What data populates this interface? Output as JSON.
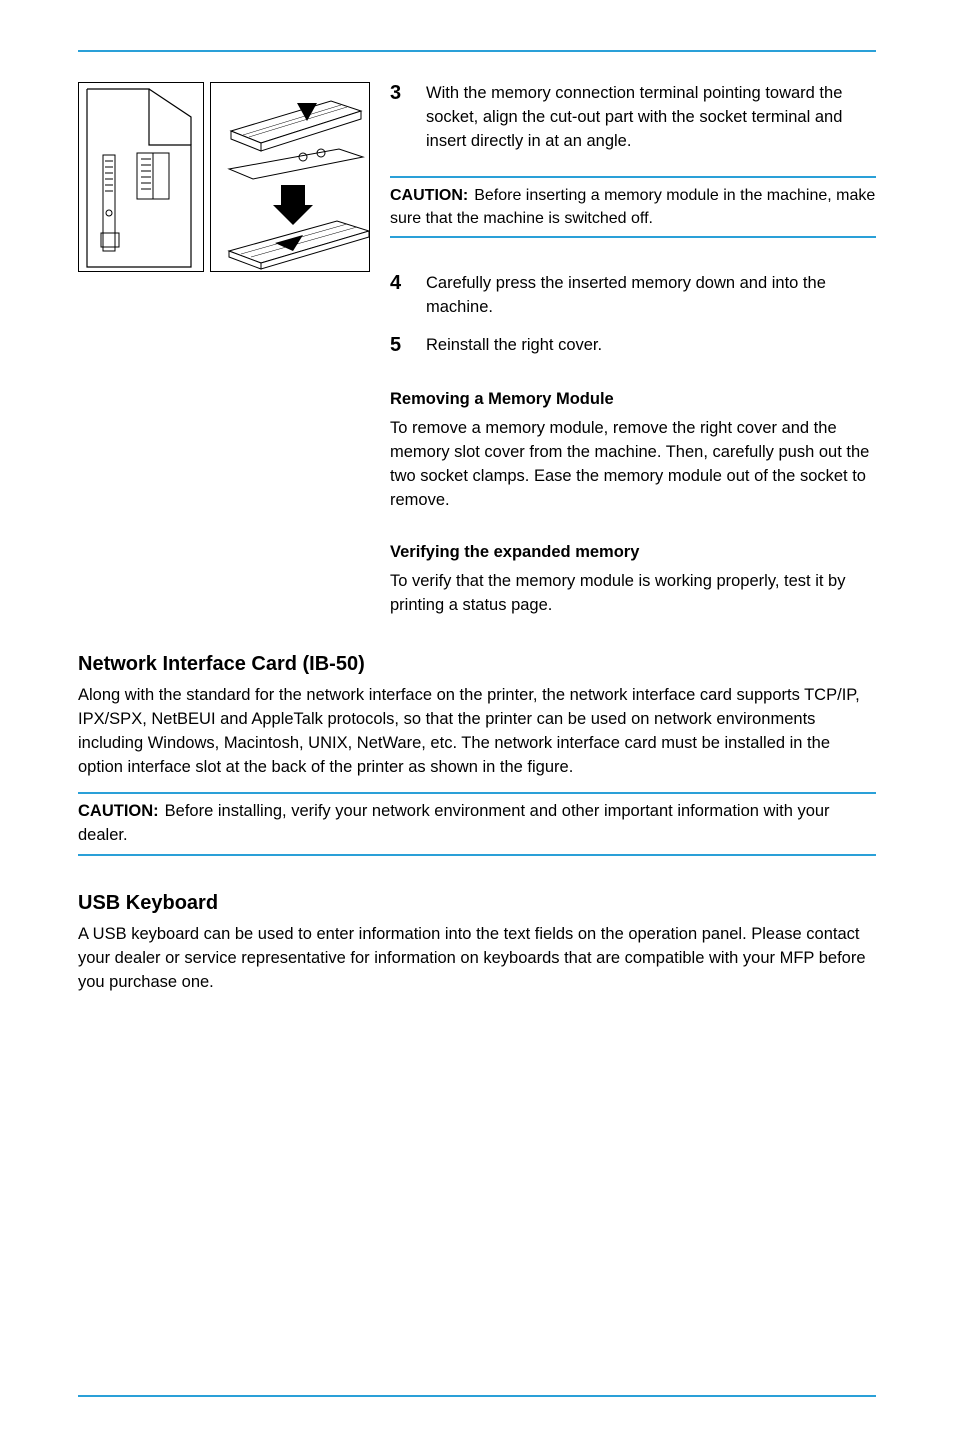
{
  "header": {
    "left": "",
    "right": ""
  },
  "steps": {
    "s3_num": "3",
    "s3_text": "With the memory connection terminal pointing toward the socket, align the cut-out part with the socket terminal and insert directly in at an angle.",
    "caution_label": "CAUTION:",
    "caution_text": "Before inserting a memory module in the machine, make sure that the machine is switched off.",
    "s4_num": "4",
    "s4_text": "Carefully press the inserted memory down and into the machine.",
    "s5_num": "5",
    "s5_text": "Reinstall the right cover."
  },
  "removing": {
    "title": "Removing a Memory Module",
    "text": "To remove a memory module, remove the right cover and the memory slot cover from the machine. Then, carefully push out the two socket clamps. Ease the memory module out of the socket to remove."
  },
  "verifying": {
    "title": "Verifying the expanded memory",
    "text": "To verify that the memory module is working properly, test it by printing a status page."
  },
  "nic": {
    "title": "Network Interface Card (IB-50)",
    "text": "Along with the standard for the network interface on the printer, the network interface card supports TCP/IP, IPX/SPX, NetBEUI and AppleTalk protocols, so that the printer can be used on network environments including Windows, Macintosh, UNIX, NetWare, etc. The network interface card must be installed in the option interface slot at the back of the printer as shown in the figure.",
    "caution_label": "CAUTION:",
    "caution_text": "Before installing, verify your network environment and other important information with your dealer."
  },
  "usb": {
    "title": "USB Keyboard",
    "text": "A USB keyboard can be used to enter information into the text fields on the operation panel. Please contact your dealer or service representative for information on keyboards that are compatible with your MFP before you purchase one."
  },
  "footer": {
    "company": "",
    "page": ""
  }
}
